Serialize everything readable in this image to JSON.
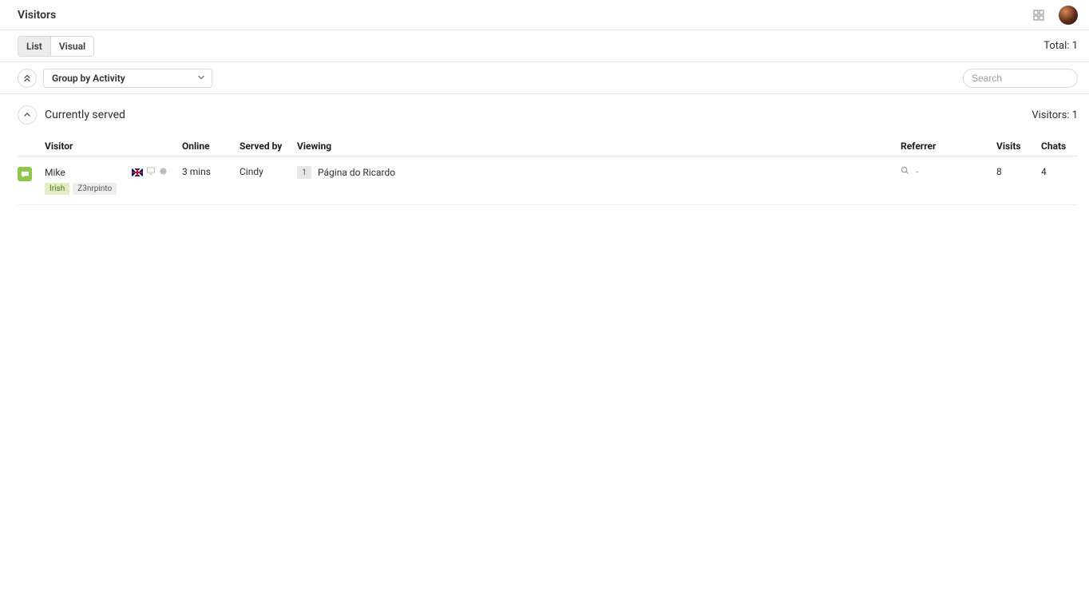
{
  "header": {
    "title": "Visitors"
  },
  "tabs": {
    "list": "List",
    "visual": "Visual",
    "total_label": "Total:",
    "total_value": "1"
  },
  "controls": {
    "group_by": "Group by Activity",
    "search_placeholder": "Search"
  },
  "section": {
    "title": "Currently served",
    "count_label": "Visitors:",
    "count_value": "1"
  },
  "columns": {
    "visitor": "Visitor",
    "online": "Online",
    "served_by": "Served by",
    "viewing": "Viewing",
    "referrer": "Referrer",
    "visits": "Visits",
    "chats": "Chats"
  },
  "rows": [
    {
      "visitor_name": "Mike",
      "tags": [
        "Irish",
        "Z3nrpinto"
      ],
      "online": "3 mins",
      "served_by": "Cindy",
      "viewing_count": "1",
      "viewing_page": "Página do Ricardo",
      "referrer": "-",
      "visits": "8",
      "chats": "4"
    }
  ]
}
